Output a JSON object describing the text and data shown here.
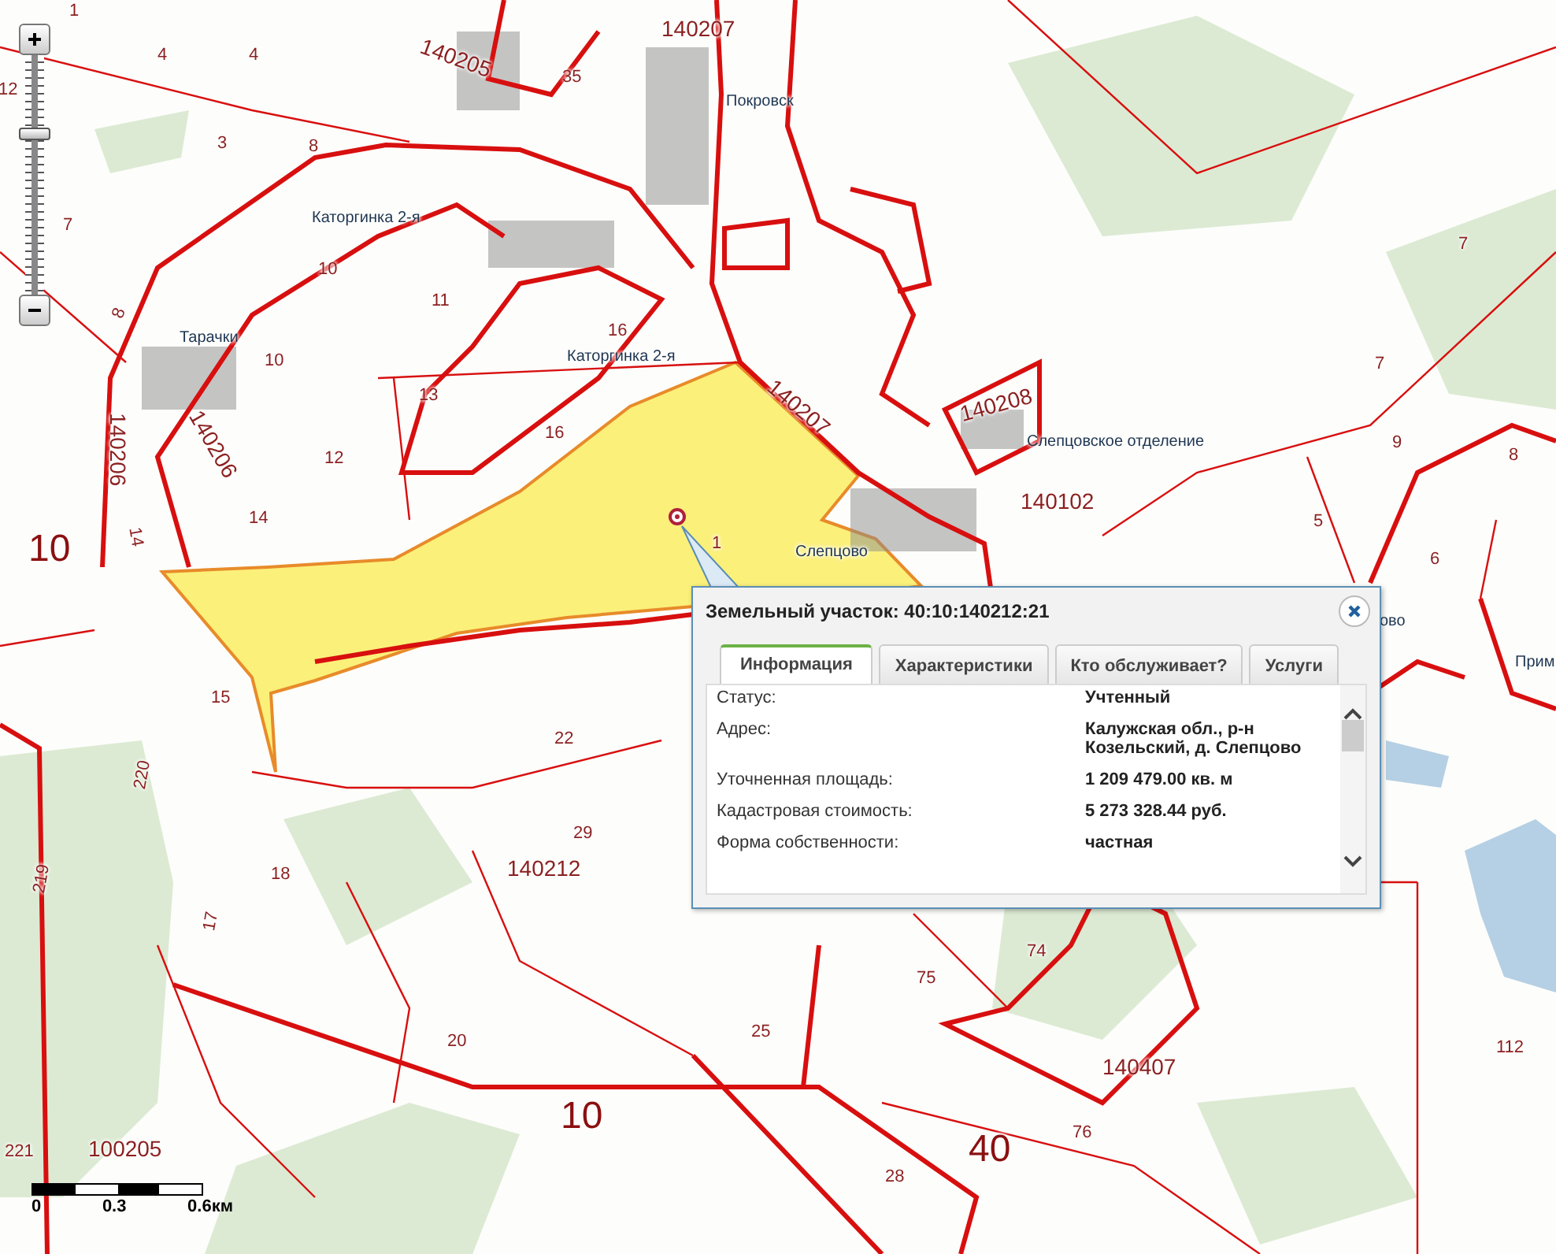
{
  "map": {
    "labels": [
      {
        "text": "1",
        "kind": "parcel"
      },
      {
        "text": "4",
        "kind": "parcel"
      },
      {
        "text": "4",
        "kind": "parcel"
      },
      {
        "text": "12",
        "kind": "parcel"
      },
      {
        "text": "3",
        "kind": "parcel"
      },
      {
        "text": "8",
        "kind": "parcel"
      },
      {
        "text": "7",
        "kind": "parcel"
      },
      {
        "text": "Каторгинка 2-я",
        "kind": "place"
      },
      {
        "text": "10",
        "kind": "parcel"
      },
      {
        "text": "11",
        "kind": "parcel"
      },
      {
        "text": "Тарачки",
        "kind": "place"
      },
      {
        "text": "10",
        "kind": "parcel"
      },
      {
        "text": "140206",
        "kind": "quarter"
      },
      {
        "text": "140206",
        "kind": "quarter"
      },
      {
        "text": "8",
        "kind": "parcel"
      },
      {
        "text": "13",
        "kind": "parcel"
      },
      {
        "text": "12",
        "kind": "parcel"
      },
      {
        "text": "14",
        "kind": "parcel"
      },
      {
        "text": "14",
        "kind": "parcel"
      },
      {
        "text": "10",
        "kind": "district"
      },
      {
        "text": "140205",
        "kind": "quarter"
      },
      {
        "text": "35",
        "kind": "parcel"
      },
      {
        "text": "140207",
        "kind": "quarter"
      },
      {
        "text": "Покровск",
        "kind": "place"
      },
      {
        "text": "16",
        "kind": "parcel"
      },
      {
        "text": "Каторгинка 2-я",
        "kind": "place"
      },
      {
        "text": "16",
        "kind": "parcel"
      },
      {
        "text": "140207",
        "kind": "quarter"
      },
      {
        "text": "140208",
        "kind": "quarter"
      },
      {
        "text": "Слепцовское отделение",
        "kind": "place"
      },
      {
        "text": "140102",
        "kind": "quarter"
      },
      {
        "text": "Слепцово",
        "kind": "place"
      },
      {
        "text": "1",
        "kind": "parcel"
      },
      {
        "text": "7",
        "kind": "parcel"
      },
      {
        "text": "7",
        "kind": "parcel"
      },
      {
        "text": "9",
        "kind": "parcel"
      },
      {
        "text": "8",
        "kind": "parcel"
      },
      {
        "text": "5",
        "kind": "parcel"
      },
      {
        "text": "6",
        "kind": "parcel"
      },
      {
        "text": "ово",
        "kind": "place"
      },
      {
        "text": "Прим",
        "kind": "place"
      },
      {
        "text": "15",
        "kind": "parcel"
      },
      {
        "text": "22",
        "kind": "parcel"
      },
      {
        "text": "29",
        "kind": "parcel"
      },
      {
        "text": "140212",
        "kind": "quarter"
      },
      {
        "text": "18",
        "kind": "parcel"
      },
      {
        "text": "17",
        "kind": "parcel"
      },
      {
        "text": "220",
        "kind": "parcel"
      },
      {
        "text": "219",
        "kind": "parcel"
      },
      {
        "text": "20",
        "kind": "parcel"
      },
      {
        "text": "25",
        "kind": "parcel"
      },
      {
        "text": "75",
        "kind": "parcel"
      },
      {
        "text": "74",
        "kind": "parcel"
      },
      {
        "text": "140407",
        "kind": "quarter"
      },
      {
        "text": "76",
        "kind": "parcel"
      },
      {
        "text": "112",
        "kind": "parcel"
      },
      {
        "text": "10",
        "kind": "district"
      },
      {
        "text": "40",
        "kind": "district"
      },
      {
        "text": "28",
        "kind": "parcel"
      },
      {
        "text": "221",
        "kind": "parcel"
      },
      {
        "text": "100205",
        "kind": "quarter"
      }
    ]
  },
  "zoom": {
    "level": 0.68
  },
  "scale": {
    "labels": [
      "0",
      "0.3",
      "0.6км"
    ]
  },
  "popup": {
    "title": "Земельный участок: 40:10:140212:21",
    "tabs": [
      {
        "label": "Информация",
        "selected": true
      },
      {
        "label": "Характеристики",
        "selected": false
      },
      {
        "label": "Кто обслуживает?",
        "selected": false
      },
      {
        "label": "Услуги",
        "selected": false
      }
    ],
    "rows": [
      {
        "label": "Статус:",
        "value": "Учтенный"
      },
      {
        "label": "Адрес:",
        "value": "Калужская обл., р-н Козельский, д. Слепцово"
      },
      {
        "label": "Уточненная площадь:",
        "value": "1 209 479.00 кв. м"
      },
      {
        "label": "Кадастровая стоимость:",
        "value": "5 273 328.44 руб."
      },
      {
        "label": "Форма собственности:",
        "value": "частная"
      }
    ]
  }
}
